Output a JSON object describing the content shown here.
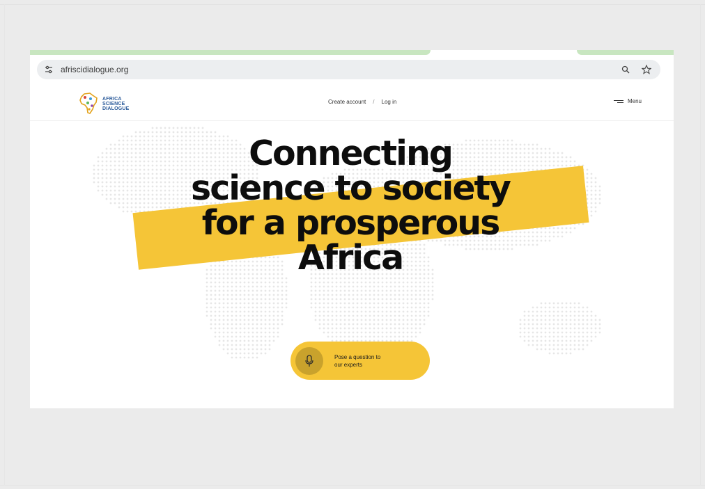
{
  "browser": {
    "url": "afriscidialogue.org",
    "icons": {
      "site_info": "tune-icon",
      "search": "search-icon",
      "bookmark": "star-icon"
    }
  },
  "site": {
    "logo": {
      "icon": "africa-map-logo-icon",
      "lines": [
        "AFRICA",
        "SCIENCE",
        "DIALOGUE"
      ]
    },
    "nav": {
      "create_account": "Create account",
      "separator": "/",
      "login": "Log in"
    },
    "menu": {
      "label": "Menu",
      "icon": "hamburger-menu-icon"
    }
  },
  "hero": {
    "headline_lines": [
      "Connecting",
      "science to society",
      "for a prosperous",
      "Africa"
    ],
    "cta": {
      "label_line1": "Pose a question to",
      "label_line2": "our experts",
      "icon": "microphone-icon"
    },
    "background_icon": "world-dot-map"
  },
  "colors": {
    "accent_yellow": "#f5c537",
    "mic_circle": "#c9a22c",
    "tab_green": "#c8e6c0",
    "text_dark": "#0d0d0d",
    "background_gray": "#ebebeb"
  }
}
